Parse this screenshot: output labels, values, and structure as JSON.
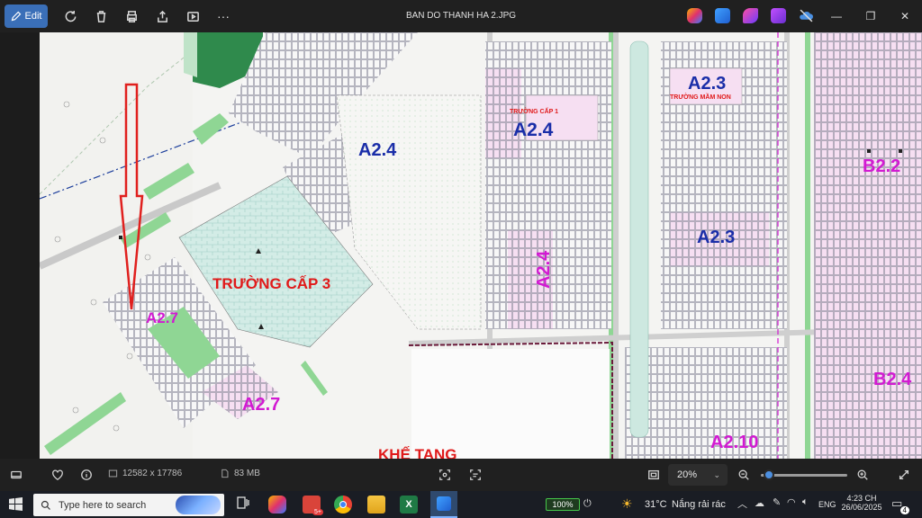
{
  "toolbar": {
    "edit_label": "Edit",
    "title": "BAN DO THANH HA 2.JPG",
    "more_label": "···"
  },
  "map": {
    "labels": {
      "a23_top": "A2.3",
      "truong_mam_non": "TRƯỜNG MẦM NON",
      "truong_cap1": "TRƯỜNG CẤP 1",
      "a24_center": "A2.4",
      "a24_left": "A2.4",
      "b22": "B2.2",
      "a24_vertical": "A2.4",
      "a23_mid": "A2.3",
      "truong_cap3": "TRƯỜNG CẤP 3",
      "a27_upper": "A2.7",
      "a27_lower": "A2.7",
      "b24": "B2.4",
      "khe_tang": "KHẾ TANG",
      "a210": "A2.10"
    },
    "colors": {
      "blue_label": "#1a2ea8",
      "magenta_label": "#d21ad2",
      "red_label": "#e01a1a",
      "arrow": "#e0201e",
      "school_fill": "#cfe9e4",
      "plot_pink": "#f3c9ef",
      "green_strip": "#8fd694"
    }
  },
  "statusbar": {
    "dimensions": "12582 x 17786",
    "filesize": "83 MB",
    "zoom": "20%",
    "zoom_fraction": 0.04
  },
  "taskbar": {
    "search_placeholder": "Type here to search",
    "battery": "100%",
    "weather_temp": "31°C",
    "weather_desc": "Nắng rải rác",
    "language": "ENG",
    "time": "4:23 CH",
    "date": "26/06/2025",
    "notifications": "4",
    "mail_badge": "5+"
  }
}
